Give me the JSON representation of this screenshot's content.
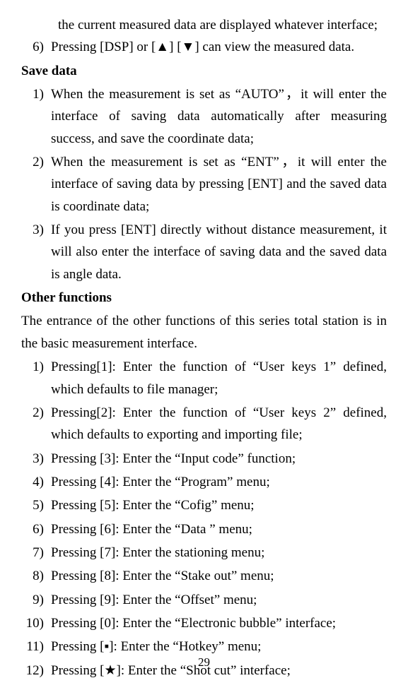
{
  "intro_items": [
    {
      "num": "",
      "text": "the current measured data are displayed whatever interface;"
    },
    {
      "num": "6)",
      "text": "Pressing [DSP] or [▲] [▼] can view the measured data."
    }
  ],
  "heading1": "Save data",
  "save_items": [
    {
      "num": "1)",
      "text": "When the measurement is set as “AUTO”，it will enter the interface of saving data automatically after measuring success, and save the coordinate data;"
    },
    {
      "num": "2)",
      "text": "When the measurement is set as “ENT”，it will enter the interface of saving data by pressing [ENT] and the saved data is coordinate data;"
    },
    {
      "num": "3)",
      "text": "If you press [ENT] directly without distance measurement, it will also enter the interface of saving data and the saved data is angle data."
    }
  ],
  "heading2": "Other functions",
  "other_intro": "The entrance of the other functions of this series total station is in the basic measurement interface.",
  "other_items": [
    {
      "num": "1)",
      "text": "Pressing[1]: Enter the function of “User keys 1” defined, which defaults to file manager;"
    },
    {
      "num": "2)",
      "text": "Pressing[2]: Enter the function of “User keys 2” defined, which defaults to exporting and importing file;"
    },
    {
      "num": "3)",
      "text": "Pressing [3]: Enter the “Input code” function;"
    },
    {
      "num": "4)",
      "text": "Pressing [4]: Enter the “Program” menu;"
    },
    {
      "num": "5)",
      "text": "Pressing [5]: Enter the “Cofig” menu;"
    },
    {
      "num": "6)",
      "text": "Pressing [6]: Enter the “Data ” menu;"
    },
    {
      "num": "7)",
      "text": "Pressing [7]: Enter the stationing menu;"
    },
    {
      "num": "8)",
      "text": "Pressing [8]: Enter the “Stake out” menu;"
    },
    {
      "num": "9)",
      "text": "Pressing [9]: Enter the “Offset” menu;"
    },
    {
      "num": "10)",
      "text": "Pressing [0]: Enter the “Electronic bubble” interface;"
    },
    {
      "num": "11)",
      "text": "Pressing [▪]: Enter the “Hotkey” menu;"
    },
    {
      "num": "12)",
      "text": "Pressing [★]: Enter the “Shot cut” interface;"
    }
  ],
  "page_number": "29"
}
